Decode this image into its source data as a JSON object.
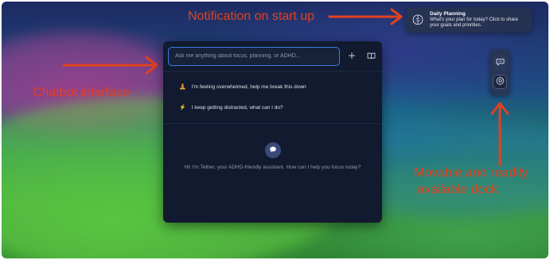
{
  "annotations": {
    "notification": "Notification on start up",
    "chatbot": "Chatbot interface",
    "dock_line1": "Movable and readily",
    "dock_line2": "available dock"
  },
  "notification": {
    "title": "Daily Planning",
    "body": "What's your plan for today? Click to share your goals and priorities.",
    "icon": "brain-icon"
  },
  "chat": {
    "input_placeholder": "Ask me anything about focus, planning, or ADHD...",
    "new_chat_icon": "plus-icon",
    "library_icon": "book-icon",
    "suggestions": [
      {
        "emoji": "🧘",
        "text": "I'm feeling overwhelmed, help me break this down"
      },
      {
        "emoji": "⚡",
        "text": "I keep getting distracted, what can I do?"
      }
    ],
    "welcome": "Hi! I'm Tether, your ADHD-friendly assistant. How can I help you focus today?"
  },
  "dock": {
    "items": [
      {
        "icon": "chat-icon"
      },
      {
        "icon": "settings-icon"
      }
    ]
  },
  "colors": {
    "annotation": "#e2411f",
    "input_border": "#3b7ee0",
    "panel_bg": "#111a2e"
  }
}
